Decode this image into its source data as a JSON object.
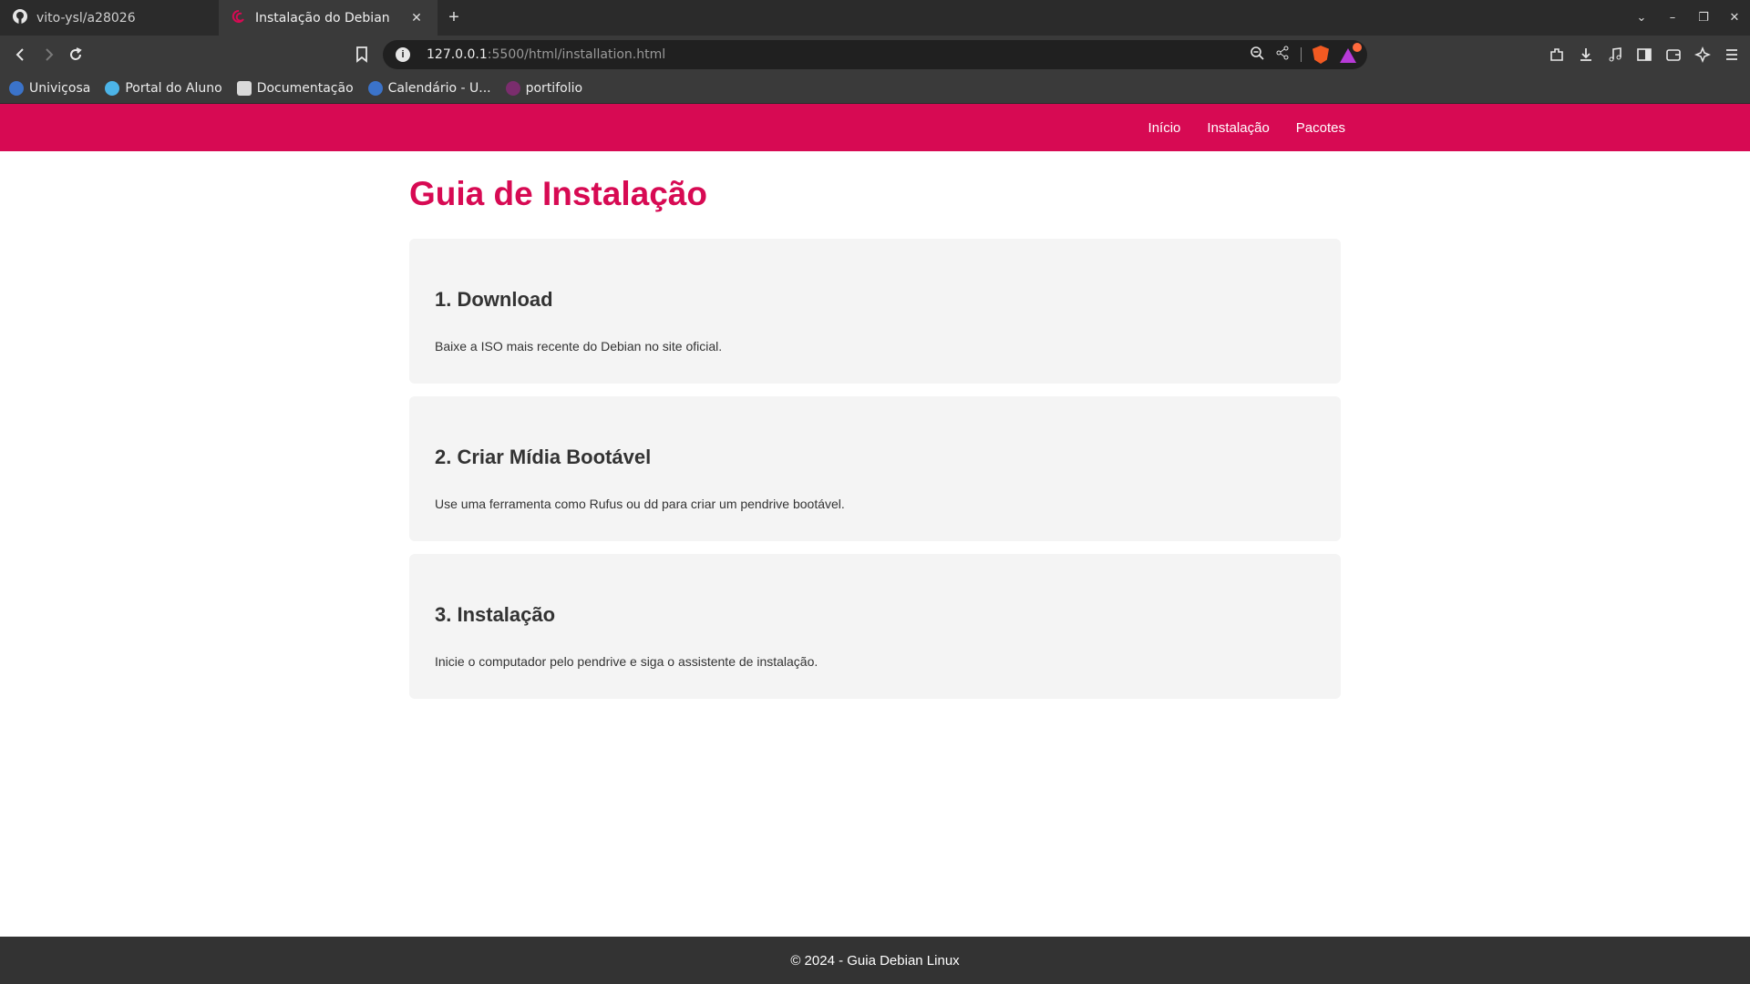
{
  "browser": {
    "tabs": [
      {
        "title": "vito-ysl/a28026",
        "icon": "github-icon",
        "active": false
      },
      {
        "title": "Instalação do Debian",
        "icon": "debian-icon",
        "active": true
      }
    ],
    "url_host": "127.0.0.1",
    "url_path": ":5500/html/installation.html",
    "bookmarks": [
      {
        "label": "Univiçosa",
        "icon": "univicosa-icon"
      },
      {
        "label": "Portal do Aluno",
        "icon": "portal-icon"
      },
      {
        "label": "Documentação",
        "icon": "search-doc-icon"
      },
      {
        "label": "Calendário - U...",
        "icon": "univicosa-icon"
      },
      {
        "label": "portifolio",
        "icon": "spider-icon"
      }
    ]
  },
  "site": {
    "accent": "#d70a53",
    "nav": [
      "Início",
      "Instalação",
      "Pacotes"
    ],
    "title": "Guia de Instalação",
    "steps": [
      {
        "heading": "1. Download",
        "text": "Baixe a ISO mais recente do Debian no site oficial."
      },
      {
        "heading": "2. Criar Mídia Bootável",
        "text": "Use uma ferramenta como Rufus ou dd para criar um pendrive bootável."
      },
      {
        "heading": "3. Instalação",
        "text": "Inicie o computador pelo pendrive e siga o assistente de instalação."
      }
    ],
    "footer": "© 2024 - Guia Debian Linux"
  }
}
